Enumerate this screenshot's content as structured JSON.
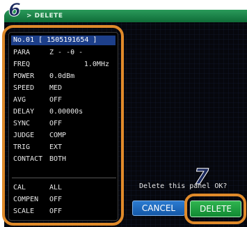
{
  "window": {
    "title": "> DELETE"
  },
  "annotations": {
    "step_info": "6",
    "step_delete": "7"
  },
  "panel": {
    "header": "No.01 [ 1505191654 ]",
    "rows": [
      {
        "label": "PARA",
        "value": "Z -  -θ -"
      },
      {
        "label": "FREQ",
        "value": "1.0MHz"
      },
      {
        "label": "POWER",
        "value": "0.0dBm"
      },
      {
        "label": "SPEED",
        "value": "MED"
      },
      {
        "label": "AVG",
        "value": "OFF"
      },
      {
        "label": "DELAY",
        "value": "0.00000s"
      },
      {
        "label": "SYNC",
        "value": "OFF"
      },
      {
        "label": "JUDGE",
        "value": "COMP"
      },
      {
        "label": "TRIG",
        "value": "EXT"
      },
      {
        "label": "CONTACT",
        "value": "BOTH"
      }
    ],
    "rows2": [
      {
        "label": "CAL",
        "value": "ALL"
      },
      {
        "label": "COMPEN",
        "value": "OFF"
      },
      {
        "label": "SCALE",
        "value": "OFF"
      }
    ]
  },
  "dialog": {
    "message": "Delete this panel OK?",
    "cancel_label": "CANCEL",
    "delete_label": "DELETE"
  },
  "colors": {
    "highlight": "#e08a2a",
    "title_bar": "#1a8a4a",
    "header_bg": "#1d3f8a",
    "cancel_bg": "#1f6cc0",
    "delete_bg": "#1f9e40"
  }
}
